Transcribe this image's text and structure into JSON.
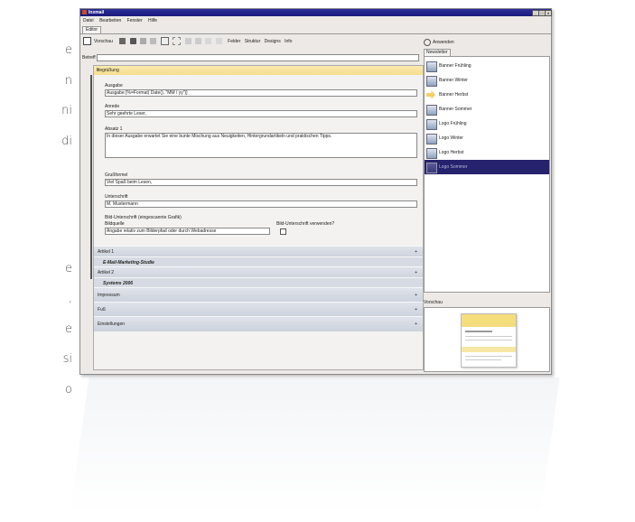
{
  "background_text": [
    "e",
    "n",
    "ni",
    "di",
    "e",
    ",",
    "e",
    "si",
    "o"
  ],
  "window": {
    "title": "Inxmail"
  },
  "menu": [
    "Datei",
    "Bearbeiten",
    "Fenster",
    "Hilfe"
  ],
  "editor_tab": "Editor",
  "toolbar": {
    "preview": "Vorschau",
    "extras": [
      "Felder",
      "Struktur",
      "Designs",
      "Info"
    ]
  },
  "betreff_label": "Betreff",
  "sections": {
    "begruessung": "Begrüßung",
    "ausgabe_label": "Ausgabe",
    "ausgabe_value": "Ausgabe [%=Format( Date(), \"MM / yy\")]",
    "anrede_label": "Anrede",
    "anrede_value": "Sehr geehrte Leser,",
    "absatz_label": "Absatz 1",
    "absatz_value": "In dieser Ausgabe erwartet Sie eine bunte Mischung aus Neuigkeiten, Hintergrundartikeln und praktischen Tipps.",
    "gruss_label": "Grußformel",
    "gruss_value": "Viel Spaß beim Lesen,",
    "unterschrift_label": "Unterschrift",
    "unterschrift_value": "M. Mustermann",
    "bild_label": "Bild-Unterschrift (eingescannte Grafik)",
    "bildquelle_label": "Bildquelle",
    "bildquelle_value": "Angabe relativ zum Bilderpfad oder durch Webadresse",
    "bild_check_label": "Bild-Unterschrift verwenden?",
    "artikel1": "Artikel 1",
    "artikel1_sub": "E-Mail-Marketing-Studie",
    "artikel2": "Artikel 2",
    "artikel2_sub": "Systems 2006",
    "impressum": "Impressum",
    "fuss": "Fuß",
    "einstellungen": "Einstellungen"
  },
  "right": {
    "apply": "Anwenden",
    "newsletter_tab": "Newsletter",
    "items": [
      "Banner Frühling",
      "Banner Winter",
      "Banner Herbst",
      "Banner Sommer",
      "Logo Frühling",
      "Logo Winter",
      "Logo Herbst",
      "Logo Sommer"
    ],
    "preview_label": "Vorschau"
  },
  "colors": {
    "title_bar": "#1a1b7a",
    "selection": "#26226d",
    "section_yellow": "#f6de8c"
  }
}
